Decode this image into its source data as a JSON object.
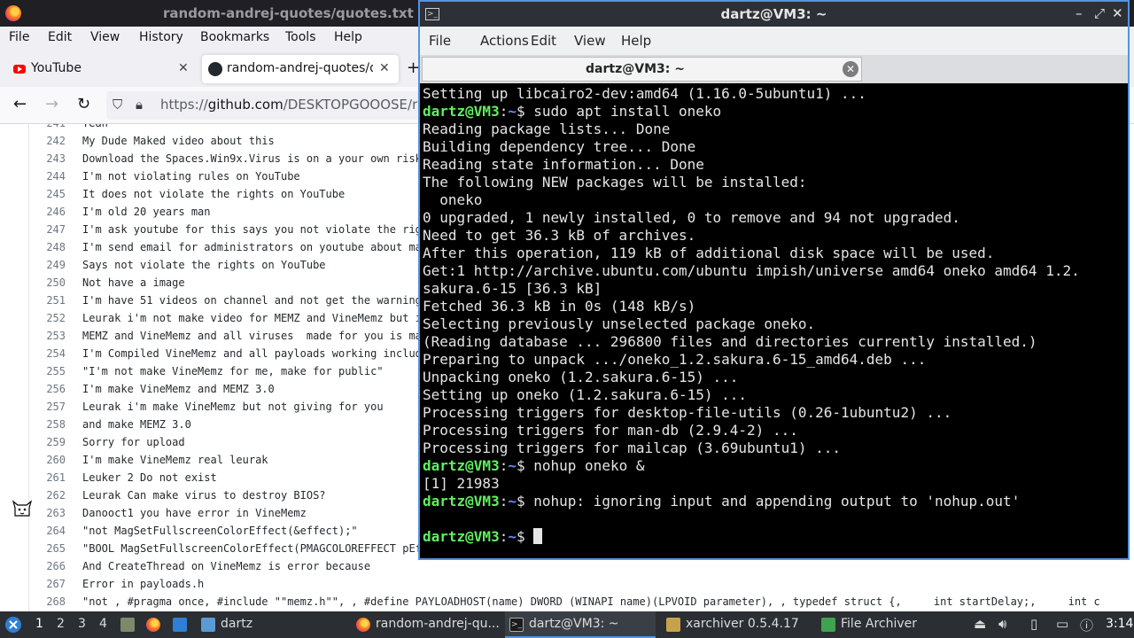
{
  "firefox": {
    "window_title": "random-andrej-quotes/quotes.txt a",
    "menu": [
      "File",
      "Edit",
      "View",
      "History",
      "Bookmarks",
      "Tools",
      "Help"
    ],
    "tabs": [
      {
        "label": "YouTube",
        "icon": "youtube-icon"
      },
      {
        "label": "random-andrej-quotes/qu",
        "icon": "github-icon"
      }
    ],
    "new_tab": "+",
    "url_scheme": "https://",
    "url_host": "github.com",
    "url_path": "/DESKTOPGOOOSE/rand",
    "lines": [
      {
        "n": "241",
        "t": "Yeah"
      },
      {
        "n": "242",
        "t": "My Dude Maked video about this"
      },
      {
        "n": "243",
        "t": "Download the Spaces.Win9x.Virus is on a your own risk"
      },
      {
        "n": "244",
        "t": "I'm not violating rules on YouTube"
      },
      {
        "n": "245",
        "t": "It does not violate the rights on YouTube"
      },
      {
        "n": "246",
        "t": "I'm old 20 years man"
      },
      {
        "n": "247",
        "t": "I'm ask youtube for this says you not violate the rig"
      },
      {
        "n": "248",
        "t": "I'm send email for administrators on youtube about ma"
      },
      {
        "n": "249",
        "t": "Says not violate the rights on YouTube"
      },
      {
        "n": "250",
        "t": "Not have a image"
      },
      {
        "n": "251",
        "t": "I'm have 51 videos on channel and not get the warning"
      },
      {
        "n": "252",
        "t": "Leurak i'm not make video for MEMZ and VineMemz but i"
      },
      {
        "n": "253",
        "t": "MEMZ and VineMemz and all viruses  made for you is ma"
      },
      {
        "n": "254",
        "t": "I'm Compiled VineMemz and all payloads working includ"
      },
      {
        "n": "255",
        "t": "\"I'm not make VineMemz for me, make for public\""
      },
      {
        "n": "256",
        "t": "I'm make VineMemz and MEMZ 3.0"
      },
      {
        "n": "257",
        "t": "Leurak i'm make VineMemz but not giving for you"
      },
      {
        "n": "258",
        "t": "and make MEMZ 3.0"
      },
      {
        "n": "259",
        "t": "Sorry for upload"
      },
      {
        "n": "260",
        "t": "I'm make VineMemz real leurak"
      },
      {
        "n": "261",
        "t": "Leuker 2 Do not exist"
      },
      {
        "n": "262",
        "t": "Leurak Can make virus to destroy BIOS?"
      },
      {
        "n": "263",
        "t": "Danooct1 you have error in VineMemz"
      },
      {
        "n": "264",
        "t": "\"not MagSetFullscreenColorEffect(&effect);\""
      },
      {
        "n": "265",
        "t": "\"BOOL MagSetFullscreenColorEffect(PMAGCOLOREFFECT pEf"
      },
      {
        "n": "266",
        "t": "And CreateThread on VineMemz is error because"
      },
      {
        "n": "267",
        "t": "Error in payloads.h"
      },
      {
        "n": "268",
        "t": "\"not , #pragma once, #include \"\"memz.h\"\", , #define PAYLOADHOST(name) DWORD (WINAPI name)(LPVOID parameter), , typedef struct {,     int startDelay;,     int c"
      }
    ]
  },
  "terminal": {
    "title": "dartz@VM3: ~",
    "menu": [
      "File",
      "Actions",
      "Edit",
      "View",
      "Help"
    ],
    "tab_label": "dartz@VM3: ~",
    "prompt_user": "dartz@VM3",
    "prompt_sep": ":",
    "prompt_path": "~",
    "prompt_end": "$ ",
    "lines": [
      {
        "text": "Setting up libcairo2-dev:amd64 (1.16.0-5ubuntu1) ..."
      },
      {
        "prompt": true,
        "text": "sudo apt install oneko"
      },
      {
        "text": "Reading package lists... Done"
      },
      {
        "text": "Building dependency tree... Done"
      },
      {
        "text": "Reading state information... Done"
      },
      {
        "text": "The following NEW packages will be installed:"
      },
      {
        "text": "  oneko"
      },
      {
        "text": "0 upgraded, 1 newly installed, 0 to remove and 94 not upgraded."
      },
      {
        "text": "Need to get 36.3 kB of archives."
      },
      {
        "text": "After this operation, 119 kB of additional disk space will be used."
      },
      {
        "text": "Get:1 http://archive.ubuntu.com/ubuntu impish/universe amd64 oneko amd64 1.2."
      },
      {
        "text": "sakura.6-15 [36.3 kB]"
      },
      {
        "text": "Fetched 36.3 kB in 0s (148 kB/s)"
      },
      {
        "text": "Selecting previously unselected package oneko."
      },
      {
        "text": "(Reading database ... 296800 files and directories currently installed.)"
      },
      {
        "text": "Preparing to unpack .../oneko_1.2.sakura.6-15_amd64.deb ..."
      },
      {
        "text": "Unpacking oneko (1.2.sakura.6-15) ..."
      },
      {
        "text": "Setting up oneko (1.2.sakura.6-15) ..."
      },
      {
        "text": "Processing triggers for desktop-file-utils (0.26-1ubuntu2) ..."
      },
      {
        "text": "Processing triggers for man-db (2.9.4-2) ..."
      },
      {
        "text": "Processing triggers for mailcap (3.69ubuntu1) ..."
      },
      {
        "prompt": true,
        "text": "nohup oneko &"
      },
      {
        "text": "[1] 21983"
      },
      {
        "prompt": true,
        "text": "nohup: ignoring input and appending output to 'nohup.out'"
      },
      {
        "text": ""
      },
      {
        "prompt": true,
        "text": "",
        "cursor": true
      }
    ]
  },
  "taskbar": {
    "workspaces": [
      "1",
      "2",
      "3",
      "4"
    ],
    "active_workspace": "1",
    "windows": [
      {
        "label": "dartz",
        "icon": "folder-icon"
      },
      {
        "label": "random-andrej-qu...",
        "icon": "firefox-icon"
      },
      {
        "label": "dartz@VM3: ~",
        "icon": "terminal-icon",
        "active": true
      },
      {
        "label": "xarchiver 0.5.4.17",
        "icon": "xarchiver-icon"
      },
      {
        "label": "File Archiver",
        "icon": "archive-icon"
      }
    ],
    "clock": "3:14"
  },
  "colors": {
    "accent": "#5294e2",
    "prompt_user": "#5ff05f",
    "prompt_path": "#6a8cff"
  }
}
